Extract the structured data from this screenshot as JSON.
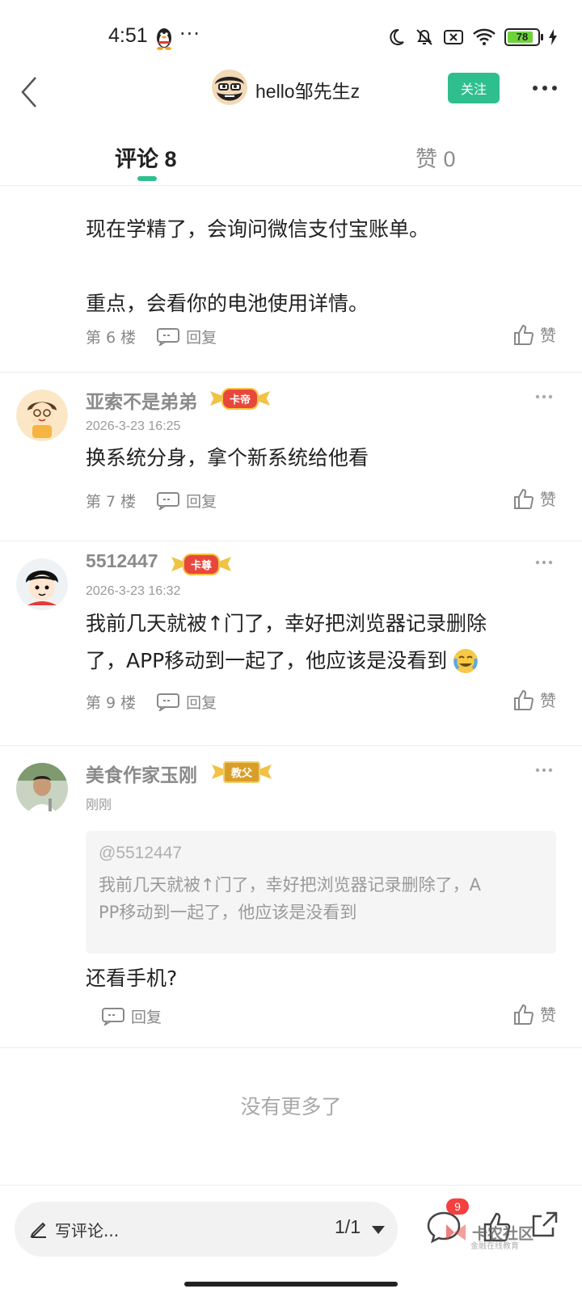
{
  "status_bar": {
    "time": "4:51",
    "dots": "···",
    "battery": "78"
  },
  "header": {
    "back_icon": "back-chevron-icon",
    "username": "hello邹先生z",
    "follow_label": "关注",
    "more_icon": "more-horizontal-icon"
  },
  "tabs": [
    {
      "label": "评论 8",
      "active": true
    },
    {
      "label": "赞 0",
      "active": false
    }
  ],
  "comments": [
    {
      "body_lines": [
        "现在学精了，会询问微信支付宝账单。",
        "",
        "重点，会看你的电池使用详情。"
      ],
      "floor": "第 6 楼",
      "reply_label": "回复",
      "like_label": "赞"
    },
    {
      "user": "亚索不是弟弟",
      "badge": "卡帝",
      "time": "2026-3-23 16:25",
      "body": "换系统分身，拿个新系统给他看",
      "floor": "第 7 楼",
      "reply_label": "回复",
      "like_label": "赞"
    },
    {
      "user": "5512447",
      "badge": "卡尊",
      "time": "2026-3-23 16:32",
      "body_line1": "我前几天就被↑门了，幸好把浏览器记录删除",
      "body_line2": "了，APP移动到一起了，他应该是没看到",
      "floor": "第 9 楼",
      "reply_label": "回复",
      "like_label": "赞"
    },
    {
      "user": "美食作家玉刚",
      "badge": "教父",
      "time": "刚刚",
      "quote_at": "@5512447",
      "quote_line1": "我前几天就被↑门了，幸好把浏览器记录删除了，A",
      "quote_line2": "PP移动到一起了，他应该是没看到",
      "body": "还看手机?",
      "reply_label": "回复",
      "like_label": "赞"
    }
  ],
  "no_more": "没有更多了",
  "bottom_bar": {
    "write_placeholder": "写评论...",
    "page": "1/1",
    "comment_count": "9",
    "watermark": "卡农社区",
    "watermark_sub": "金融在线教育"
  },
  "colors": {
    "accent": "#2fbf8f",
    "badge_red": "#e8483b",
    "badge_gold": "#d99e2a"
  }
}
